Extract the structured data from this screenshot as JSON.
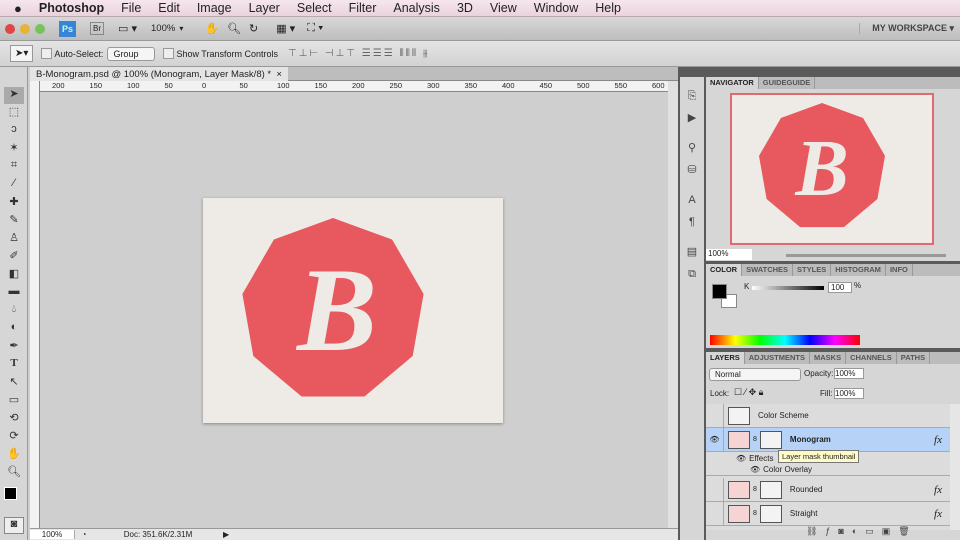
{
  "menubar": {
    "apple": "",
    "items": [
      "Photoshop",
      "File",
      "Edit",
      "Image",
      "Layer",
      "Select",
      "Filter",
      "Analysis",
      "3D",
      "View",
      "Window",
      "Help"
    ]
  },
  "appbar": {
    "ps": "Ps",
    "br": "Br",
    "zoom": "100%",
    "workspace": "MY WORKSPACE ▾"
  },
  "options": {
    "auto_select": "Auto-Select:",
    "group": "Group",
    "show_transform": "Show Transform Controls"
  },
  "document": {
    "tab": "B-Monogram.psd @ 100% (Monogram, Layer Mask/8) *",
    "close": "×",
    "ruler": [
      "200",
      "150",
      "100",
      "50",
      "0",
      "50",
      "100",
      "150",
      "200",
      "250",
      "300",
      "350",
      "400",
      "450",
      "500",
      "550",
      "600"
    ],
    "letter": "B",
    "badge_color": "#e8595f",
    "paper_color": "#eeeae6"
  },
  "status": {
    "zoom": "100%",
    "doc": "Doc: 351.6K/2.31M"
  },
  "navigator": {
    "tabs": [
      "NAVIGATOR",
      "GUIDEGUIDE"
    ],
    "zoom": "100%"
  },
  "color": {
    "tabs": [
      "COLOR",
      "SWATCHES",
      "STYLES",
      "HISTOGRAM",
      "INFO"
    ],
    "channel": "K",
    "value": "100",
    "unit": "%"
  },
  "layers": {
    "tabs": [
      "LAYERS",
      "ADJUSTMENTS",
      "MASKS",
      "CHANNELS",
      "PATHS"
    ],
    "blend": "Normal",
    "opacity_label": "Opacity:",
    "opacity": "100%",
    "lock": "Lock:",
    "fill_label": "Fill:",
    "fill": "100%",
    "items": [
      {
        "name": "Color Scheme"
      },
      {
        "name": "Monogram",
        "fx": "fx"
      },
      {
        "name": "Rounded",
        "fx": "fx"
      },
      {
        "name": "Straight",
        "fx": "fx"
      }
    ],
    "effects": "Effects",
    "color_overlay": "Color Overlay",
    "tooltip": "Layer mask thumbnail"
  }
}
